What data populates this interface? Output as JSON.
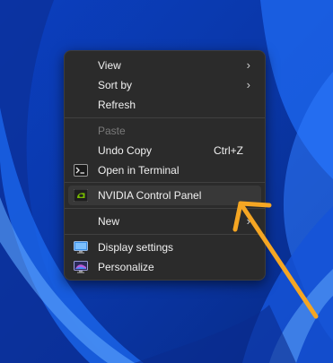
{
  "menu": {
    "items": [
      {
        "label": "View",
        "submenu": true
      },
      {
        "label": "Sort by",
        "submenu": true
      },
      {
        "label": "Refresh"
      },
      {
        "label": "Paste",
        "disabled": true
      },
      {
        "label": "Undo Copy",
        "shortcut": "Ctrl+Z"
      },
      {
        "label": "Open in Terminal",
        "icon": "terminal-icon"
      },
      {
        "label": "NVIDIA Control Panel",
        "icon": "nvidia-icon",
        "highlighted": true
      },
      {
        "label": "New",
        "submenu": true
      },
      {
        "label": "Display settings",
        "icon": "display-icon"
      },
      {
        "label": "Personalize",
        "icon": "personalize-icon"
      }
    ],
    "submenu_glyph": "›"
  },
  "colors": {
    "menu_bg": "#2b2b2b",
    "accent_arrow": "#f5a623",
    "wallpaper": "#0a3cb8"
  }
}
